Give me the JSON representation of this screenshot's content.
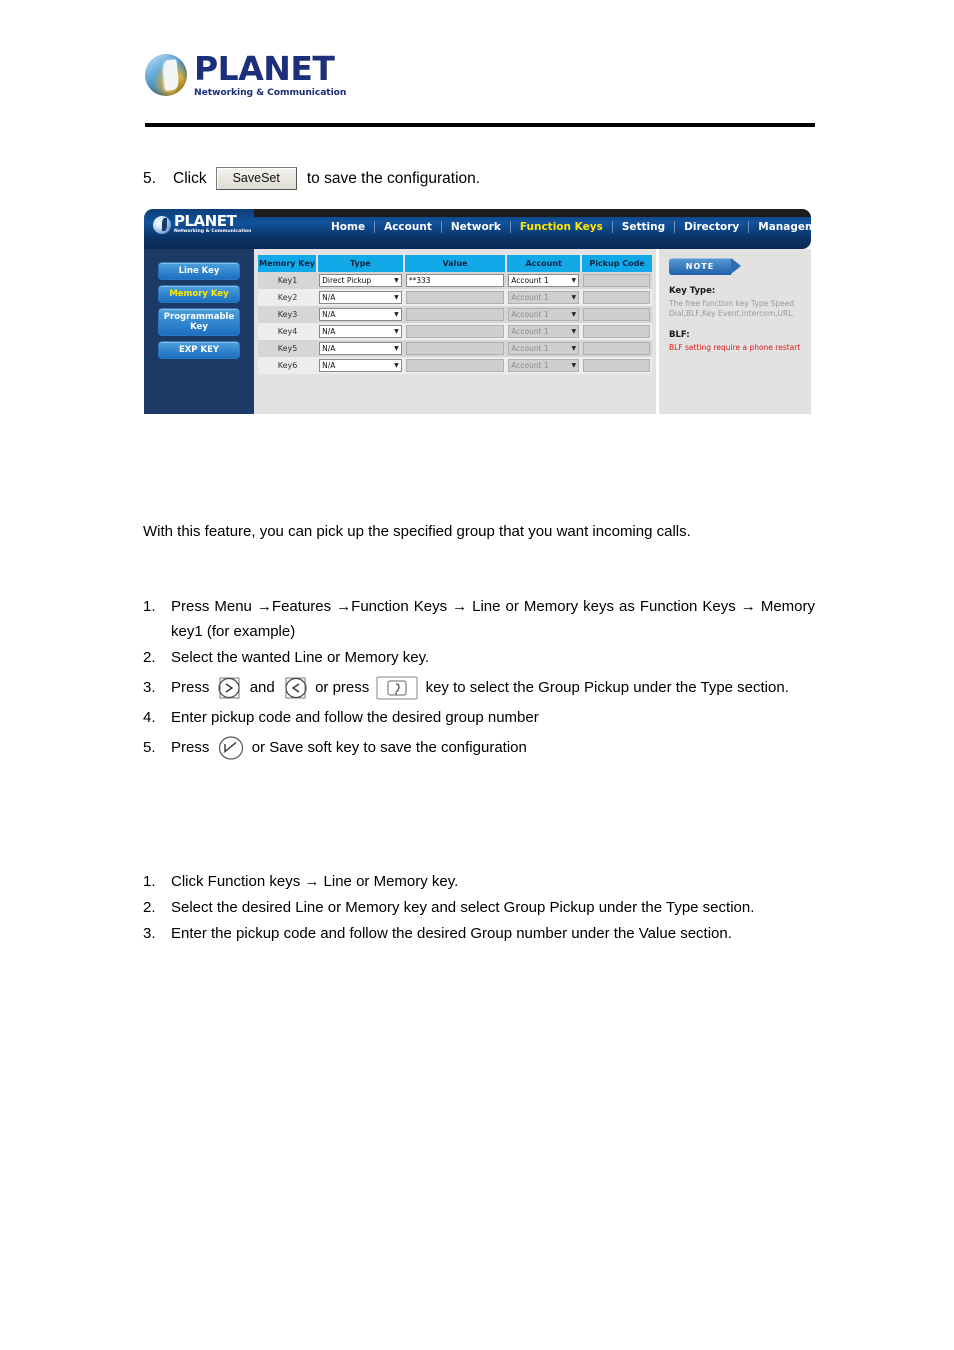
{
  "brand": {
    "name": "PLANET",
    "tagline": "Networking & Communication"
  },
  "step5_line": {
    "number": "5.",
    "click_label": "Click",
    "button_label": "SaveSet",
    "tail_label": "to save the configuration."
  },
  "webui": {
    "logo": {
      "name": "PLANET",
      "tagline": "Networking & Communication"
    },
    "nav": [
      {
        "label": "Home",
        "active": false
      },
      {
        "label": "Account",
        "active": false
      },
      {
        "label": "Network",
        "active": false
      },
      {
        "label": "Function Keys",
        "active": true
      },
      {
        "label": "Setting",
        "active": false
      },
      {
        "label": "Directory",
        "active": false
      },
      {
        "label": "Management",
        "active": false
      }
    ],
    "sidebar": [
      {
        "label": "Line Key",
        "active": false
      },
      {
        "label": "Memory Key",
        "active": true
      },
      {
        "label": "Programmable Key",
        "active": false
      },
      {
        "label": "EXP KEY",
        "active": false
      }
    ],
    "table": {
      "headers": [
        "Memory Key",
        "Type",
        "Value",
        "Account",
        "Pickup Code"
      ],
      "rows": [
        {
          "key": "Key1",
          "type": "Direct Pickup",
          "value": "**333",
          "account": "Account 1",
          "pickup": "",
          "enabled": true
        },
        {
          "key": "Key2",
          "type": "N/A",
          "value": "",
          "account": "Account 1",
          "pickup": "",
          "enabled": false
        },
        {
          "key": "Key3",
          "type": "N/A",
          "value": "",
          "account": "Account 1",
          "pickup": "",
          "enabled": false
        },
        {
          "key": "Key4",
          "type": "N/A",
          "value": "",
          "account": "Account 1",
          "pickup": "",
          "enabled": false
        },
        {
          "key": "Key5",
          "type": "N/A",
          "value": "",
          "account": "Account 1",
          "pickup": "",
          "enabled": false
        },
        {
          "key": "Key6",
          "type": "N/A",
          "value": "",
          "account": "Account 1",
          "pickup": "",
          "enabled": false
        }
      ]
    },
    "note": {
      "badge": "NOTE",
      "key_type_heading": "Key Type:",
      "key_type_text": "The free function key Type Speed Dial,BLF,Key Event,intercom,URL.",
      "blf_heading": "BLF:",
      "blf_text": "BLF setting require a phone restart"
    },
    "colors": {
      "nav_active": "#ffe800",
      "table_header": "#12a9e8",
      "note_warning": "#e01b1b",
      "sidebar_bg": "#1b3a66"
    }
  },
  "intro": "With this feature, you can pick up the specified group that you want incoming calls.",
  "phone_steps": {
    "items": [
      {
        "number": "1.",
        "text": "Press Menu →Features →Function Keys → Line or Memory keys as Function Keys → Memory key1 (for example)"
      },
      {
        "number": "2.",
        "text": "Select the wanted Line or Memory key."
      },
      {
        "number": "3.",
        "text_before": "Press",
        "text_mid": "and",
        "text_mid2": "or press",
        "text_after": "key to select the Group Pickup under the Type section."
      },
      {
        "number": "4.",
        "text": "Enter pickup code and follow the desired group number"
      },
      {
        "number": "5.",
        "text_before": "Press",
        "text_after": "or Save soft key to save the configuration"
      }
    ]
  },
  "web_steps": {
    "items": [
      {
        "number": "1.",
        "text": "Click Function keys → Line or Memory key."
      },
      {
        "number": "2.",
        "text": "Select the desired Line or Memory key and select Group Pickup under the Type section."
      },
      {
        "number": "3.",
        "text": "Enter the pickup code and follow the desired Group number under the Value section."
      }
    ]
  },
  "icons": {
    "right_nav_key": "nav-right-key-icon",
    "left_nav_key": "nav-left-key-icon",
    "switch_key": "switch-key-icon",
    "ok_check_key": "ok-check-key-icon"
  }
}
